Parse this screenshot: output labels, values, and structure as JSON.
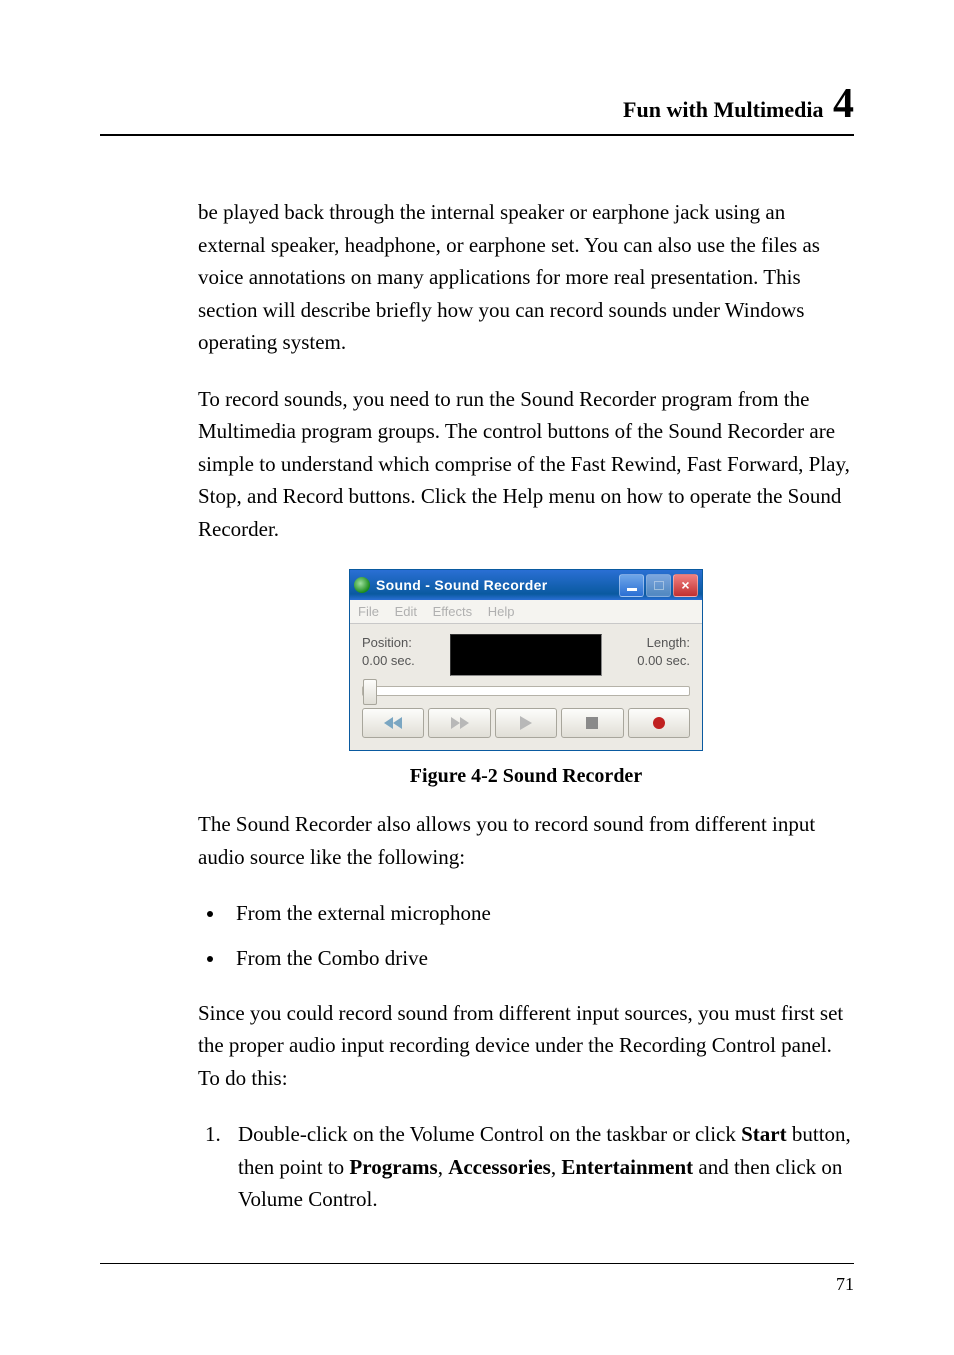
{
  "header": {
    "title": "Fun with Multimedia ",
    "chapter": "4"
  },
  "paragraphs": {
    "p1": "be played back through the internal speaker or earphone jack using an external speaker, headphone, or earphone set. You can also use the files as voice annotations on many applications for more real presentation. This section will describe briefly how you can record sounds under Windows operating system.",
    "p2": "To record sounds, you need to run the Sound Recorder program from the Multimedia program groups. The control buttons of the Sound Recorder are simple to understand which comprise of the Fast Rewind, Fast Forward, Play, Stop, and Record buttons. Click the Help menu on how to operate the Sound Recorder.",
    "p3": "The Sound Recorder also allows you to record sound from different input audio source like the following:",
    "p4": "Since you could record sound from different input sources, you must first set the proper audio input recording device under the Recording Control panel. To do this:"
  },
  "sound_recorder": {
    "title": "Sound - Sound Recorder",
    "menus": {
      "file": "File",
      "edit": "Edit",
      "effects": "Effects",
      "help": "Help"
    },
    "position_label": "Position:",
    "position_value": "0.00 sec.",
    "length_label": "Length:",
    "length_value": "0.00 sec."
  },
  "figure_caption": "Figure 4-2    Sound Recorder",
  "bullets": {
    "b1": "From the external microphone",
    "b2": "From the Combo drive"
  },
  "step1": {
    "pre": "Double-click on the Volume Control on the taskbar or click ",
    "start": "Start",
    "mid1": " button, then point to ",
    "programs": "Programs",
    "comma1": ", ",
    "accessories": "Accessories",
    "comma2": ", ",
    "entertainment": "Entertainment",
    "post": " and then click on Volume Control."
  },
  "page_number": "71"
}
